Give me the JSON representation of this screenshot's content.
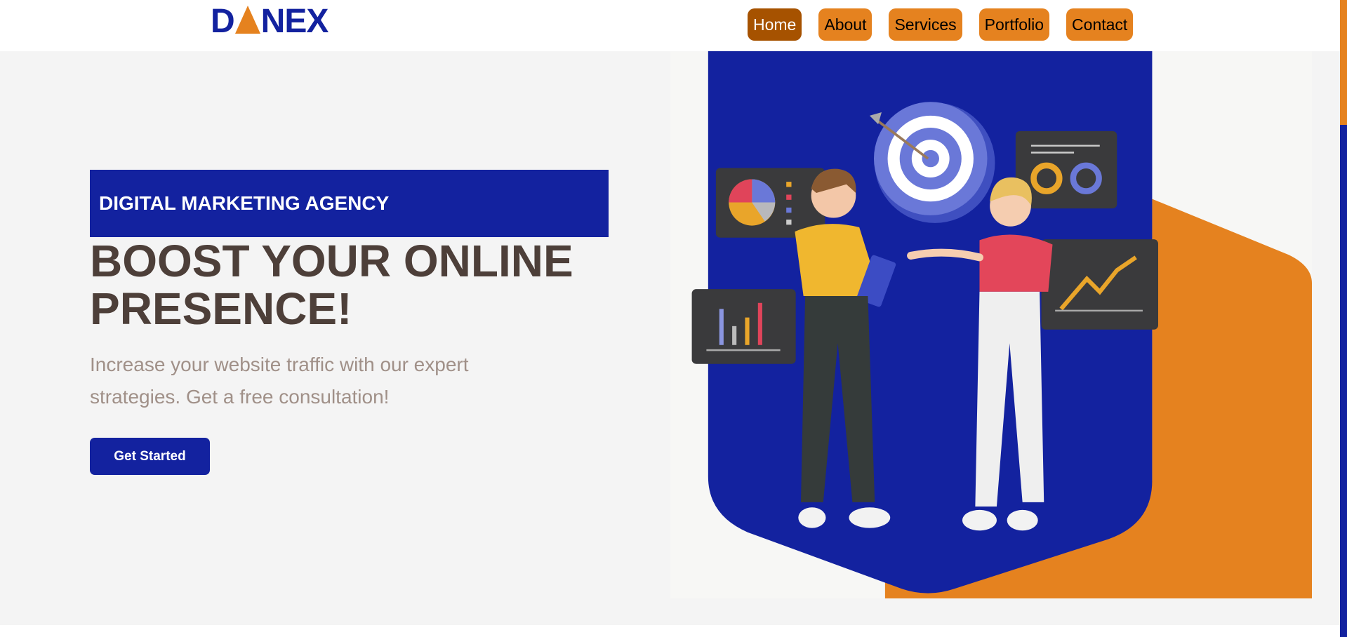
{
  "header": {
    "logo": {
      "text": "DANEX",
      "left": "D",
      "right": "NEX"
    },
    "nav": [
      {
        "label": "Home",
        "active": true
      },
      {
        "label": "About",
        "active": false
      },
      {
        "label": "Services",
        "active": false
      },
      {
        "label": "Portfolio",
        "active": false
      },
      {
        "label": "Contact",
        "active": false
      }
    ]
  },
  "hero": {
    "tag": "DIGITAL MARKETING AGENCY",
    "title_line1": "BOOST YOUR ONLINE",
    "title_line2": "PRESENCE!",
    "subtitle": "Increase your website traffic with our expert strategies. Get a free consultation!",
    "cta_label": "Get Started"
  },
  "colors": {
    "brand_blue": "#13229f",
    "brand_orange": "#e5821f",
    "nav_active": "#a65200",
    "heading": "#4d3f39",
    "subtext": "#a09088",
    "background": "#f4f4f4"
  },
  "illustration": {
    "icon": "marketing-team-illustration"
  }
}
